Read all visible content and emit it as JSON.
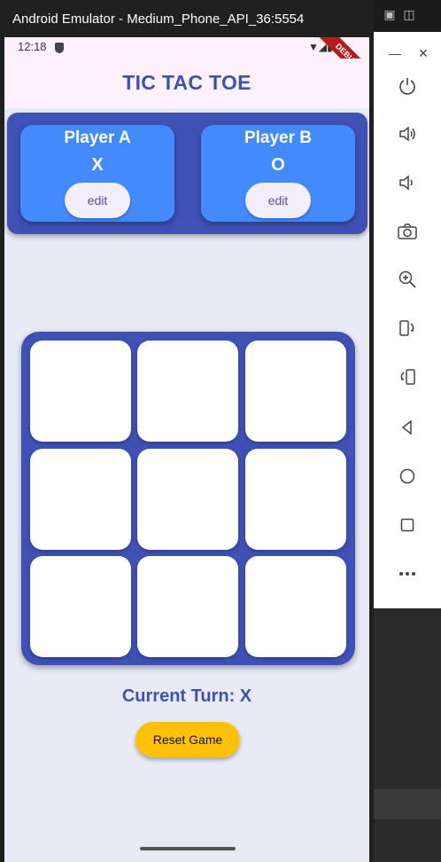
{
  "window": {
    "title": "Android Emulator - Medium_Phone_API_36:5554"
  },
  "statusbar": {
    "time": "12:18",
    "debug_label": "DEBUG"
  },
  "app": {
    "title": "TIC TAC TOE"
  },
  "players": [
    {
      "name": "Player A",
      "symbol": "X",
      "edit_label": "edit"
    },
    {
      "name": "Player B",
      "symbol": "O",
      "edit_label": "edit"
    }
  ],
  "board": {
    "cells": [
      "",
      "",
      "",
      "",
      "",
      "",
      "",
      "",
      ""
    ]
  },
  "turn": {
    "text": "Current Turn: X"
  },
  "reset": {
    "label": "Reset Game"
  },
  "toolbar": {
    "items": [
      "power-icon",
      "volume-up-icon",
      "volume-down-icon",
      "camera-icon",
      "zoom-icon",
      "rotate-left-icon",
      "rotate-right-icon",
      "back-icon",
      "home-icon",
      "overview-icon",
      "more-icon"
    ]
  },
  "colors": {
    "primary": "#3f51b5",
    "player_card": "#448aff",
    "reset": "#ffc107",
    "background": "#e8eaf6"
  }
}
